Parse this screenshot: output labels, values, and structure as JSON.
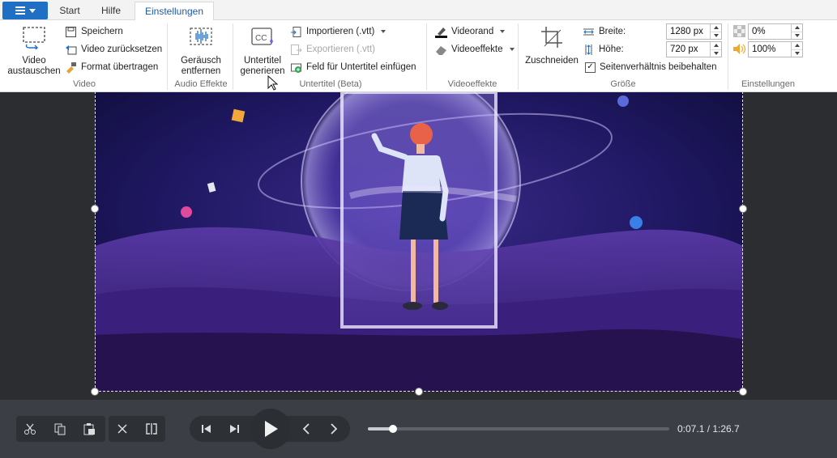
{
  "tabs": [
    {
      "label": "Start"
    },
    {
      "label": "Hilfe"
    },
    {
      "label": "Einstellungen"
    }
  ],
  "ribbon": {
    "video": {
      "group_label": "Video",
      "replace_line1": "Video",
      "replace_line2": "austauschen",
      "save": "Speichern",
      "reset": "Video zurücksetzen",
      "format": "Format übertragen"
    },
    "audio": {
      "group_label": "Audio Effekte",
      "noise_line1": "Geräusch",
      "noise_line2": "entfernen"
    },
    "subtitles": {
      "group_label": "Untertitel (Beta)",
      "generate_line1": "Untertitel",
      "generate_line2": "generieren",
      "import": "Importieren (.vtt)",
      "export": "Exportieren (.vtt)",
      "add_field": "Feld für Untertitel einfügen"
    },
    "effects": {
      "group_label": "Videoeffekte",
      "border": "Videorand",
      "effects": "Videoeffekte"
    },
    "size": {
      "group_label": "Größe",
      "crop": "Zuschneiden",
      "width_label": "Breite:",
      "width_value": "1280 px",
      "height_label": "Höhe:",
      "height_value": "720 px",
      "keep_ratio": "Seitenverhältnis beibehalten",
      "keep_ratio_checked": true
    },
    "settings": {
      "group_label": "Einstellungen",
      "transparency_value": "0%",
      "volume_value": "100%"
    }
  },
  "player": {
    "current_time": "0:07.1",
    "total_time": "1:26.7",
    "time_display": "0:07.1 / 1:26.7",
    "progress": 0.082
  },
  "colors": {
    "accent": "#1f6fc5",
    "stage_bg": "#2b2d31",
    "controls_bg": "#3b3e44"
  }
}
